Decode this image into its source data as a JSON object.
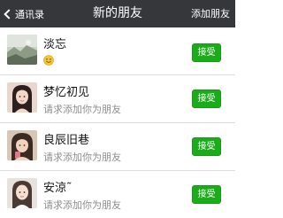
{
  "navbar": {
    "back_label": "通讯录",
    "title": "新的朋友",
    "action_label": "添加朋友"
  },
  "requests": [
    {
      "name": "淡忘",
      "message": "",
      "has_emoji": true,
      "button_label": "接受"
    },
    {
      "name": "梦忆初见",
      "message": "请求添加你为朋友",
      "has_emoji": false,
      "button_label": "接受"
    },
    {
      "name": "良辰旧巷",
      "message": "请求添加你为朋友",
      "has_emoji": false,
      "button_label": "接受"
    },
    {
      "name": "安涼˜",
      "message": "请求添加你为朋友",
      "has_emoji": false,
      "button_label": "接受"
    }
  ],
  "colors": {
    "navbar_bg": "#35373b",
    "accept_green": "#1aad19",
    "secondary_text": "#8e8e8e"
  }
}
